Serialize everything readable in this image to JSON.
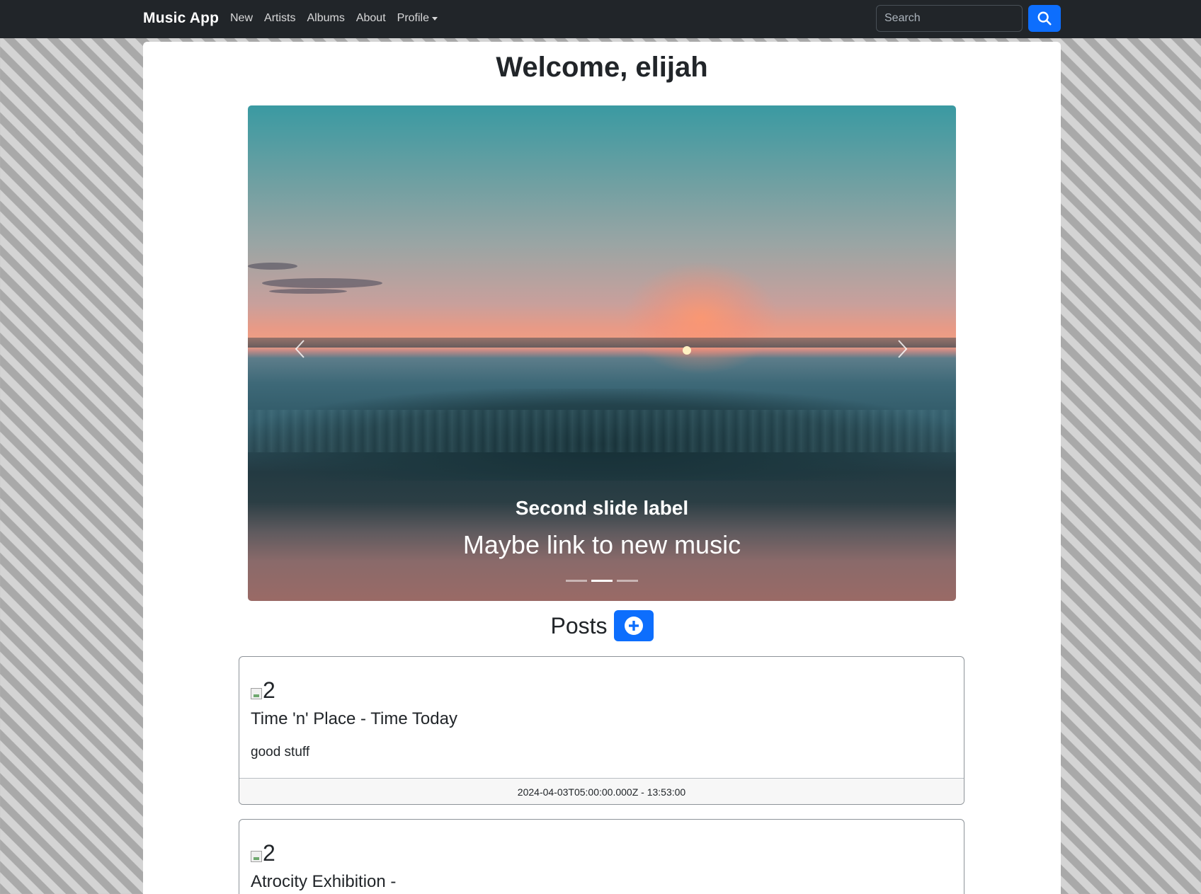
{
  "navbar": {
    "brand": "Music App",
    "links": [
      "New",
      "Artists",
      "Albums",
      "About",
      "Profile"
    ],
    "search_placeholder": "Search",
    "search_icon": "search-icon"
  },
  "main": {
    "welcome": "Welcome, elijah",
    "carousel": {
      "caption_title": "Second slide label",
      "caption_text": "Maybe link to new music",
      "indicator_count": 3,
      "active_indicator": 2
    },
    "posts_title": "Posts",
    "add_icon": "plus-circle-icon",
    "posts": [
      {
        "image_alt": "2",
        "title": "Time 'n' Place - Time Today",
        "body": "good stuff",
        "footer": "2024-04-03T05:00:00.000Z - 13:53:00"
      },
      {
        "image_alt": "2",
        "title": "Atrocity Exhibition -",
        "body": "",
        "footer": ""
      }
    ]
  },
  "colors": {
    "navbar_bg": "#212529",
    "primary": "#0d6efd"
  }
}
